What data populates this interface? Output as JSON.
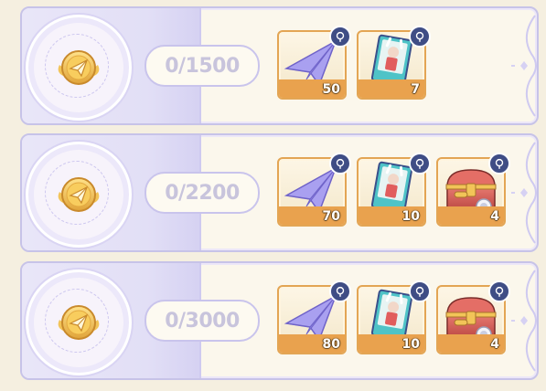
{
  "colors": {
    "accent_lavender": "#c7c3e8",
    "reward_orange": "#e9a24e",
    "counter_text": "#c8c4dc",
    "info_badge": "#3f4d85"
  },
  "rows": [
    {
      "medal_icon": "paper-plane-coin-icon",
      "progress": "0/1500",
      "rewards": [
        {
          "item": "paper-plane-icon",
          "quantity": "50"
        },
        {
          "item": "character-card-icon",
          "quantity": "7"
        }
      ]
    },
    {
      "medal_icon": "paper-plane-coin-icon",
      "progress": "0/2200",
      "rewards": [
        {
          "item": "paper-plane-icon",
          "quantity": "70"
        },
        {
          "item": "character-card-icon",
          "quantity": "10"
        },
        {
          "item": "treasure-chest-icon",
          "quantity": "4"
        }
      ]
    },
    {
      "medal_icon": "paper-plane-coin-icon",
      "progress": "0/3000",
      "rewards": [
        {
          "item": "paper-plane-icon",
          "quantity": "80"
        },
        {
          "item": "character-card-icon",
          "quantity": "10"
        },
        {
          "item": "treasure-chest-icon",
          "quantity": "4"
        }
      ]
    }
  ]
}
